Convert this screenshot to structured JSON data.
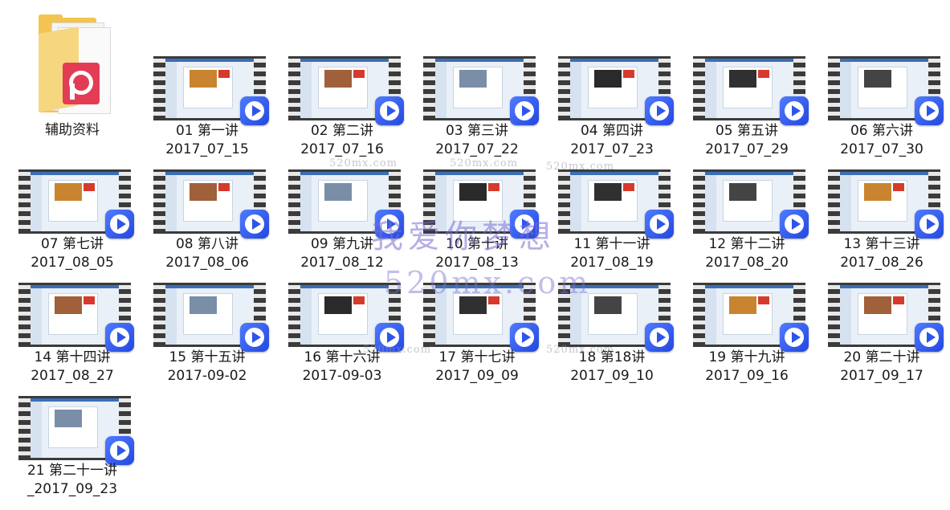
{
  "folder": {
    "label": "辅助资料",
    "icon": "pdf-folder-icon"
  },
  "videos": [
    {
      "line1": "01 第一讲",
      "line2": "2017_07_15"
    },
    {
      "line1": "02 第二讲",
      "line2": "2017_07_16"
    },
    {
      "line1": "03 第三讲",
      "line2": "2017_07_22"
    },
    {
      "line1": "04 第四讲",
      "line2": "2017_07_23"
    },
    {
      "line1": "05 第五讲",
      "line2": "2017_07_29"
    },
    {
      "line1": "06 第六讲",
      "line2": "2017_07_30"
    },
    {
      "line1": "07 第七讲",
      "line2": "2017_08_05"
    },
    {
      "line1": "08 第八讲",
      "line2": "2017_08_06"
    },
    {
      "line1": "09 第九讲",
      "line2": "2017_08_12"
    },
    {
      "line1": "10 第十讲",
      "line2": "2017_08_13"
    },
    {
      "line1": "11 第十一讲",
      "line2": "2017_08_19"
    },
    {
      "line1": "12 第十二讲",
      "line2": "2017_08_20"
    },
    {
      "line1": "13 第十三讲",
      "line2": "2017_08_26"
    },
    {
      "line1": "14 第十四讲",
      "line2": "2017_08_27"
    },
    {
      "line1": "15 第十五讲",
      "line2": "2017-09-02"
    },
    {
      "line1": "16 第十六讲",
      "line2": "2017-09-03"
    },
    {
      "line1": "17 第十七讲",
      "line2": "2017_09_09"
    },
    {
      "line1": "18 第18讲",
      "line2": "2017_09_10"
    },
    {
      "line1": "19 第十九讲",
      "line2": "2017_09_16"
    },
    {
      "line1": "20 第二十讲",
      "line2": "2017_09_17"
    },
    {
      "line1": "21 第二十一讲",
      "line2": "_2017_09_23"
    }
  ],
  "watermark": {
    "text": "我爱你梦想",
    "url": "520mx.com",
    "url_small": "520mx.com"
  },
  "colors": {
    "play_badge": "#2d55ea",
    "film": "#3b3b3b",
    "folder": "#f3c451",
    "pdf": "#e23d55"
  }
}
